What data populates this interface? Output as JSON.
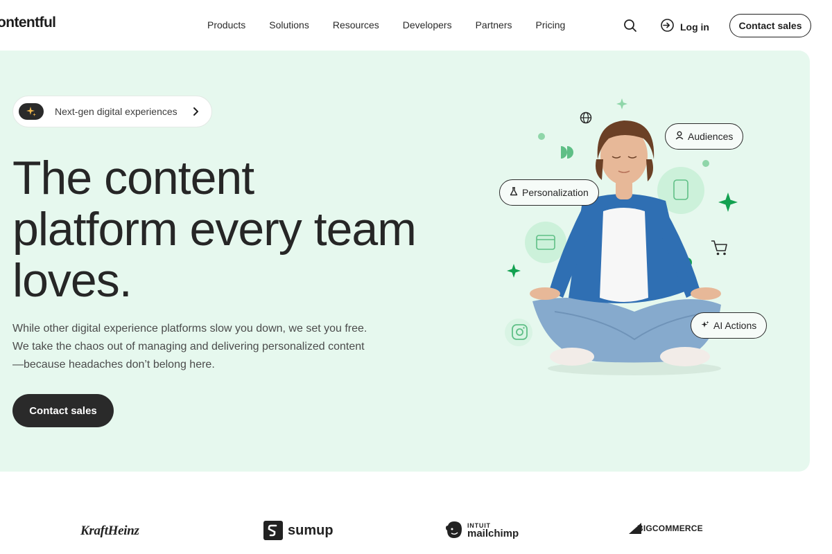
{
  "brand": {
    "logo_text": "ontentful"
  },
  "nav": {
    "links": [
      "Products",
      "Solutions",
      "Resources",
      "Developers",
      "Partners",
      "Pricing"
    ],
    "login_label": "Log in",
    "contact_label": "Contact sales"
  },
  "hero": {
    "pill_label": "Next-gen digital experiences",
    "headline_lines": [
      "The content",
      "platform every team",
      "loves."
    ],
    "subtext": "While other digital experience platforms slow you down, we set you free. We take the chaos out of managing and delivering personalized content—because headaches don’t belong here.",
    "cta_label": "Contact sales",
    "tags": {
      "personalization": "Personalization",
      "audiences": "Audiences",
      "ai_actions": "AI Actions"
    }
  },
  "logos": {
    "kraft": "KraftHeinz",
    "sumup": "sumup",
    "mailchimp_top": "INTUIT",
    "mailchimp_bottom": "mailchimp",
    "bigcommerce": "BIGCOMMERCE"
  },
  "colors": {
    "hero_bg": "#e6f8ee",
    "accent_green": "#12a150",
    "dark": "#2a2a2a"
  },
  "icons": [
    "search-icon",
    "login-arrow-icon",
    "sparkle-icon",
    "chevron-right-icon",
    "globe-icon",
    "cart-icon",
    "instagram-icon",
    "person-icon",
    "flask-icon",
    "ai-sparkle-icon"
  ]
}
